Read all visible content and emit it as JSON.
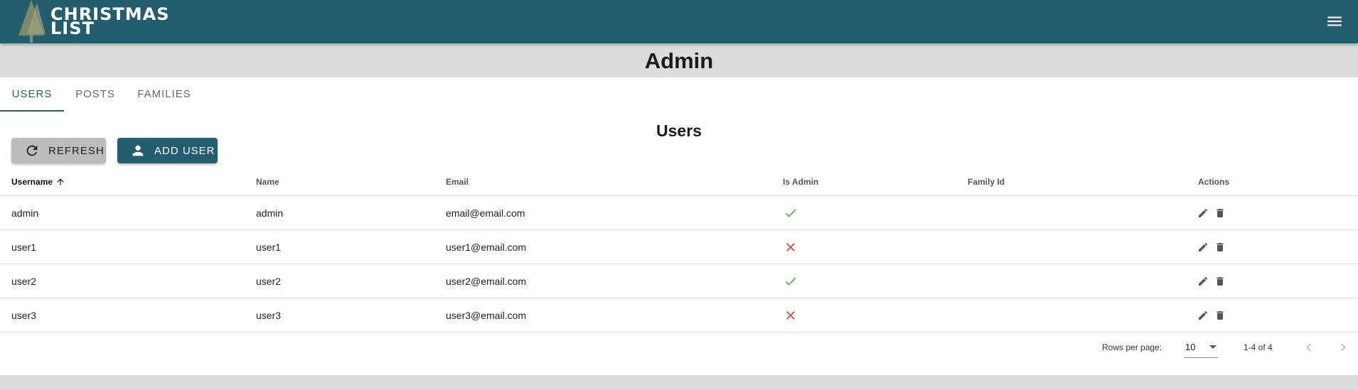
{
  "appbar": {
    "logo_text": "CHRISTMAS LIST",
    "menu_icon": "menu-icon",
    "color": "#235e6f"
  },
  "page": {
    "title": "Admin"
  },
  "tabs": [
    {
      "label": "USERS",
      "active": true
    },
    {
      "label": "POSTS",
      "active": false
    },
    {
      "label": "FAMILIES",
      "active": false
    }
  ],
  "section": {
    "title": "Users"
  },
  "toolbar": {
    "refresh_label": "REFRESH",
    "add_user_label": "ADD USER"
  },
  "table": {
    "columns": [
      "Username",
      "Name",
      "Email",
      "Is Admin",
      "Family Id",
      "Actions"
    ],
    "sort": {
      "column": "Username",
      "direction": "ascending"
    },
    "rows": [
      {
        "username": "admin",
        "name": "admin",
        "email": "email@email.com",
        "is_admin": true,
        "family_id": ""
      },
      {
        "username": "user1",
        "name": "user1",
        "email": "user1@email.com",
        "is_admin": false,
        "family_id": ""
      },
      {
        "username": "user2",
        "name": "user2",
        "email": "user2@email.com",
        "is_admin": true,
        "family_id": ""
      },
      {
        "username": "user3",
        "name": "user3",
        "email": "user3@email.com",
        "is_admin": false,
        "family_id": ""
      }
    ]
  },
  "pagination": {
    "rows_per_page_label": "Rows per page:",
    "rows_per_page": "10",
    "range": "1-4 of 4"
  },
  "colors": {
    "check": "#4caf50",
    "cross": "#e53935"
  }
}
